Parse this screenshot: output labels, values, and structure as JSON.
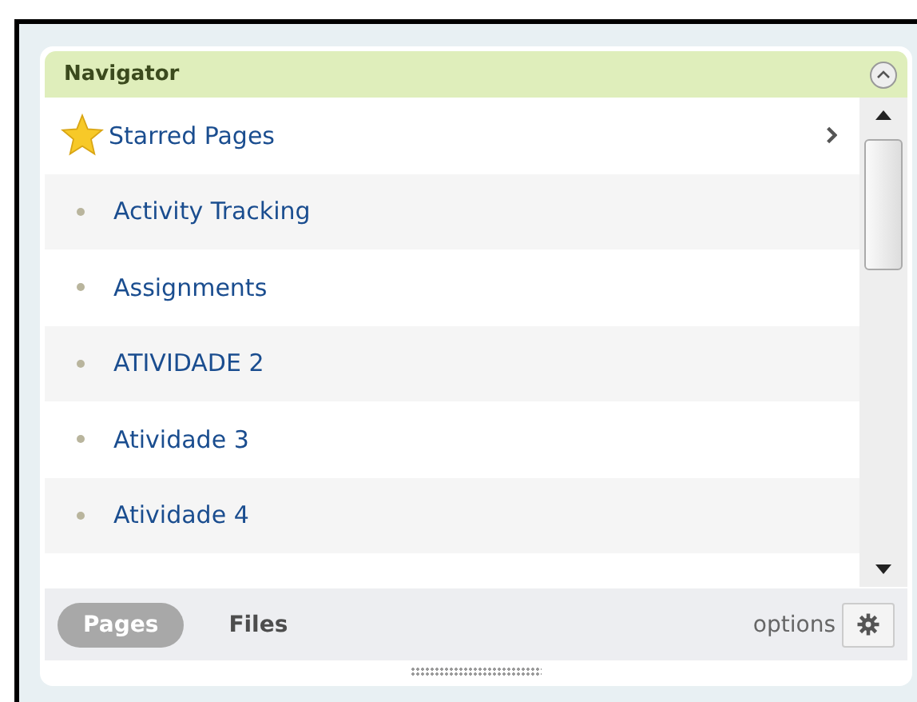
{
  "panel": {
    "title": "Navigator",
    "expanded": true
  },
  "items": [
    {
      "kind": "starred",
      "label": "Starred Pages"
    },
    {
      "kind": "page",
      "label": "Activity Tracking"
    },
    {
      "kind": "page",
      "label": "Assignments"
    },
    {
      "kind": "page",
      "label": "ATIVIDADE 2"
    },
    {
      "kind": "page",
      "label": "Atividade 3"
    },
    {
      "kind": "page",
      "label": "Atividade 4"
    }
  ],
  "tabs": [
    {
      "label": "Pages",
      "selected": true
    },
    {
      "label": "Files",
      "selected": false
    }
  ],
  "options": {
    "label": "options"
  }
}
